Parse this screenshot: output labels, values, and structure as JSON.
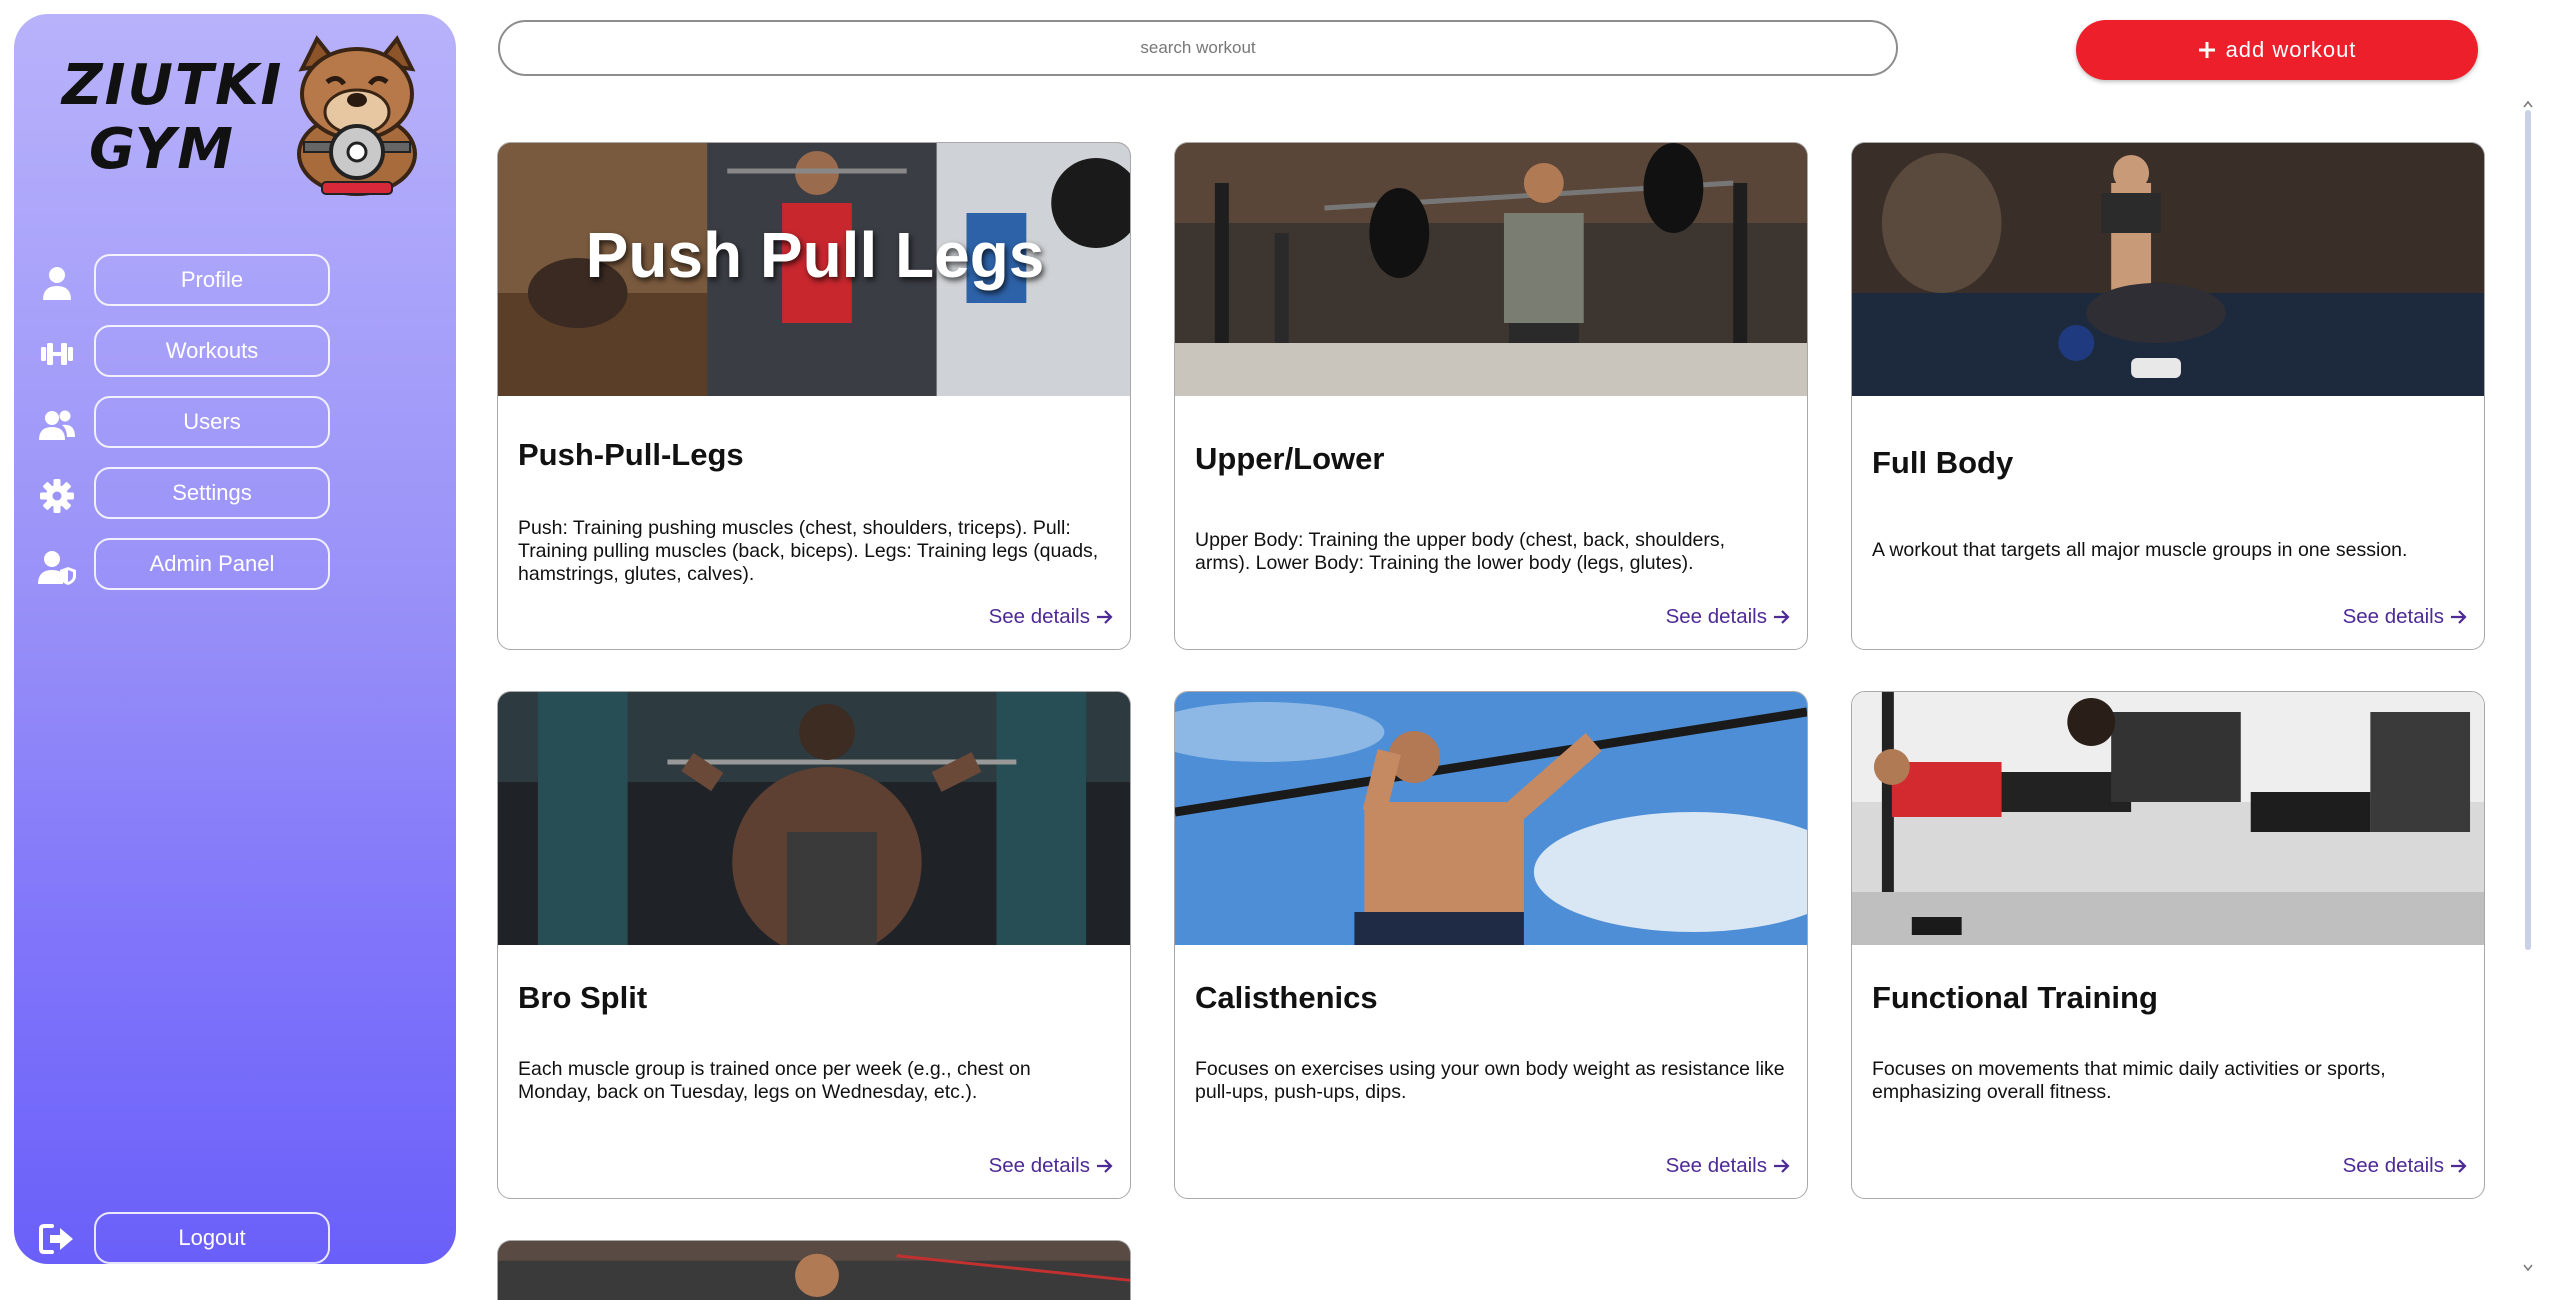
{
  "brand": {
    "line1": "ZIUTKI",
    "line2": "GYM"
  },
  "nav": {
    "items": [
      {
        "label": "Profile",
        "icon": "user-icon"
      },
      {
        "label": "Workouts",
        "icon": "dumbbell-icon"
      },
      {
        "label": "Users",
        "icon": "users-icon"
      },
      {
        "label": "Settings",
        "icon": "gear-icon"
      },
      {
        "label": "Admin Panel",
        "icon": "user-shield-icon"
      }
    ],
    "logout": {
      "label": "Logout",
      "icon": "logout-icon"
    }
  },
  "search": {
    "placeholder": "search workout"
  },
  "add_button": {
    "label": "add workout",
    "icon": "plus-icon"
  },
  "cards": [
    {
      "title": "Push-Pull-Legs",
      "image_overlay_text": "Push Pull Legs",
      "description": "Push: Training pushing muscles (chest, shoulders, triceps). Pull: Training pulling muscles (back, biceps). Legs: Training legs (quads, hamstrings, glutes, calves).",
      "link": "See details"
    },
    {
      "title": "Upper/Lower",
      "description": "Upper Body: Training the upper body (chest, back, shoulders, arms). Lower Body: Training the lower body (legs, glutes).",
      "link": "See details"
    },
    {
      "title": "Full Body",
      "description": "A workout that targets all major muscle groups in one session.",
      "link": "See details"
    },
    {
      "title": "Bro Split",
      "description": "Each muscle group is trained once per week (e.g., chest on Monday, back on Tuesday, legs on Wednesday, etc.).",
      "link": "See details"
    },
    {
      "title": "Calisthenics",
      "description": "Focuses on exercises using your own body weight as resistance like pull-ups, push-ups, dips.",
      "link": "See details"
    },
    {
      "title": "Functional Training",
      "description": "Focuses on movements that mimic daily activities or sports, emphasizing overall fitness.",
      "link": "See details"
    }
  ],
  "colors": {
    "accent": "#ec1f2a",
    "sidebar_top": "#b8b2fb",
    "sidebar_bottom": "#6a5ff9",
    "link": "#4d2a96"
  }
}
